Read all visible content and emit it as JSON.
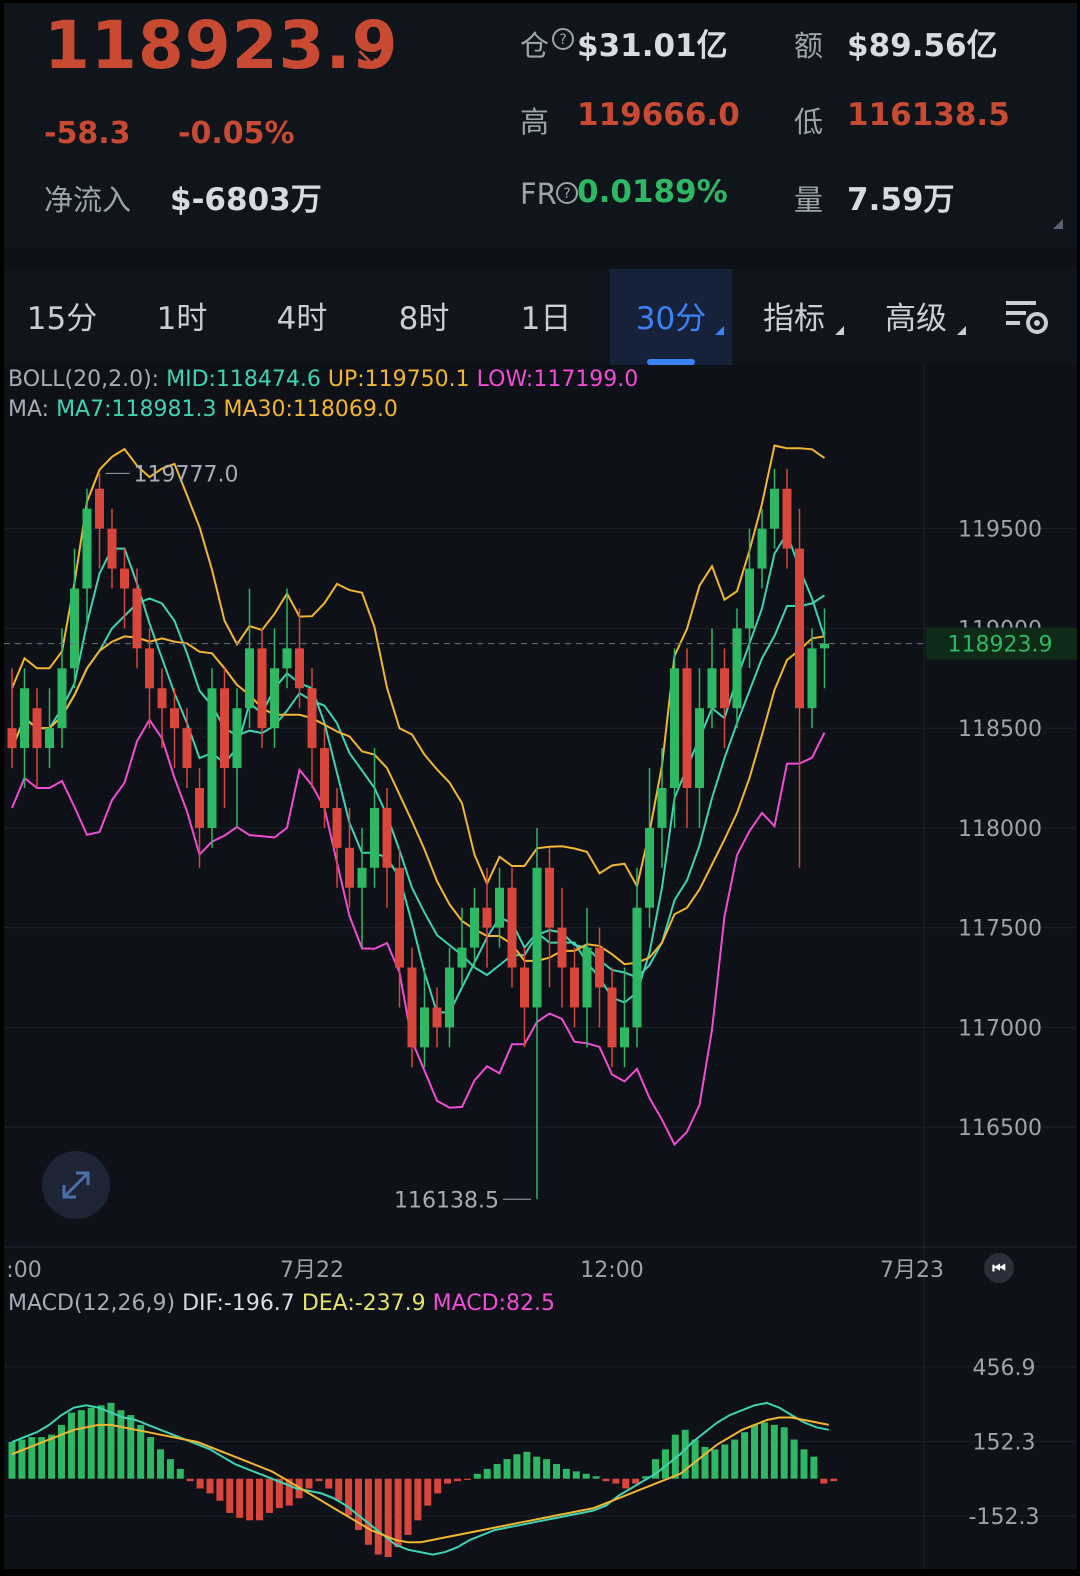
{
  "header": {
    "price": "118923.9",
    "change": "-58.3",
    "change_pct": "-0.05%",
    "net_inflow_label": "净流入",
    "net_inflow_value": "$-6803万",
    "oi_label": "仓",
    "oi_value": "$31.01亿",
    "turnover_label": "额",
    "turnover_value": "$89.56亿",
    "high_label": "高",
    "high_value": "119666.0",
    "low_label": "低",
    "low_value": "116138.5",
    "fr_label": "FR",
    "fr_value": "0.0189%",
    "volume_label": "量",
    "volume_value": "7.59万"
  },
  "tabs": [
    {
      "label": "15分"
    },
    {
      "label": "1时"
    },
    {
      "label": "4时"
    },
    {
      "label": "8时"
    },
    {
      "label": "1日"
    },
    {
      "label": "30分"
    },
    {
      "label": "指标"
    },
    {
      "label": "高级"
    }
  ],
  "active_tab": "30分",
  "icons": {
    "settings": "chart-settings-icon",
    "expand": "expand-icon",
    "rewind": "rewind-to-latest-icon",
    "help": "question-circle-icon"
  },
  "colors": {
    "up": "#2fb864",
    "down": "#d9463b",
    "mid": "#3fd3b4",
    "upper": "#f2b632",
    "lower": "#f04dd6",
    "dif": "#3fd3b4",
    "dea": "#f2b632"
  },
  "legends": {
    "boll_prefix": "BOLL(20,2.0):",
    "boll_mid": "MID:118474.6",
    "boll_up": "UP:119750.1",
    "boll_low": "LOW:117199.0",
    "ma_prefix": "MA:",
    "ma7": "MA7:118981.3",
    "ma30": "MA30:118069.0",
    "macd_prefix": "MACD(12,26,9)",
    "macd_dif": "DIF:-196.7",
    "macd_dea": "DEA:-237.9",
    "macd_val": "MACD:82.5"
  },
  "chart_data": {
    "type": "candlestick",
    "ylim": [
      116000,
      120200
    ],
    "y_ticks": [
      119500,
      119000,
      118500,
      118000,
      117500,
      117000,
      116500
    ],
    "y_tick_labels": [
      "119500",
      "119000",
      "118500",
      "118000",
      "117500",
      "117000",
      "116500"
    ],
    "x_labels": [
      {
        "text": ":00",
        "index": 0
      },
      {
        "text": "7月22",
        "index": 24
      },
      {
        "text": "12:00",
        "index": 48
      },
      {
        "text": "7月23",
        "index": 72
      }
    ],
    "last_price": 118923.9,
    "last_price_label": "118923.9",
    "max_marker": {
      "value": 119777.0,
      "label": "119777.0",
      "index": 7
    },
    "min_marker": {
      "value": 116138.5,
      "label": "116138.5",
      "index": 42
    },
    "candles": [
      [
        118500,
        118400,
        118800,
        118300
      ],
      [
        118400,
        118700,
        118800,
        118200
      ],
      [
        118600,
        118400,
        118700,
        118200
      ],
      [
        118400,
        118500,
        118700,
        118300
      ],
      [
        118500,
        118800,
        119000,
        118400
      ],
      [
        118800,
        119200,
        119400,
        118700
      ],
      [
        119200,
        119600,
        119700,
        119000
      ],
      [
        119700,
        119500,
        119777,
        119300
      ],
      [
        119500,
        119300,
        119600,
        119200
      ],
      [
        119300,
        119200,
        119400,
        119000
      ],
      [
        119200,
        118900,
        119300,
        118800
      ],
      [
        118900,
        118700,
        119000,
        118500
      ],
      [
        118700,
        118600,
        118800,
        118400
      ],
      [
        118600,
        118500,
        118700,
        118300
      ],
      [
        118500,
        118300,
        118600,
        118200
      ],
      [
        118200,
        118000,
        118300,
        117800
      ],
      [
        118000,
        118700,
        118800,
        117900
      ],
      [
        118700,
        118300,
        118800,
        118100
      ],
      [
        118300,
        118600,
        118700,
        118000
      ],
      [
        118600,
        118900,
        119200,
        118500
      ],
      [
        118900,
        118500,
        119000,
        118400
      ],
      [
        118500,
        118800,
        119000,
        118400
      ],
      [
        118800,
        118900,
        119200,
        118700
      ],
      [
        118900,
        118700,
        119100,
        118600
      ],
      [
        118700,
        118400,
        118800,
        118200
      ],
      [
        118400,
        118100,
        118500,
        118000
      ],
      [
        118100,
        117900,
        118200,
        117700
      ],
      [
        117900,
        117700,
        118100,
        117600
      ],
      [
        117700,
        117800,
        118000,
        117400
      ],
      [
        117800,
        118100,
        118400,
        117700
      ],
      [
        118100,
        117800,
        118200,
        117600
      ],
      [
        117800,
        117300,
        117900,
        117100
      ],
      [
        117300,
        116900,
        117400,
        116800
      ],
      [
        116900,
        117100,
        117300,
        116800
      ],
      [
        117100,
        117000,
        117200,
        116900
      ],
      [
        117000,
        117300,
        117400,
        116900
      ],
      [
        117300,
        117400,
        117600,
        117200
      ],
      [
        117400,
        117600,
        117700,
        117300
      ],
      [
        117600,
        117500,
        117800,
        117300
      ],
      [
        117500,
        117700,
        117800,
        117400
      ],
      [
        117700,
        117300,
        117800,
        117200
      ],
      [
        117300,
        117100,
        117400,
        116900
      ],
      [
        117100,
        117800,
        118000,
        116138.5
      ],
      [
        117800,
        117500,
        117900,
        117200
      ],
      [
        117500,
        117300,
        117700,
        117100
      ],
      [
        117300,
        117100,
        117400,
        117000
      ],
      [
        117100,
        117400,
        117600,
        116900
      ],
      [
        117400,
        117200,
        117500,
        117000
      ],
      [
        117200,
        116900,
        117300,
        116800
      ],
      [
        116900,
        117000,
        117300,
        116800
      ],
      [
        117000,
        117600,
        117800,
        116900
      ],
      [
        117600,
        118000,
        118300,
        117500
      ],
      [
        118000,
        118200,
        118400,
        117800
      ],
      [
        118200,
        118800,
        118900,
        118000
      ],
      [
        118800,
        118200,
        118900,
        118000
      ],
      [
        118200,
        118600,
        118800,
        118000
      ],
      [
        118600,
        118800,
        119000,
        118500
      ],
      [
        118800,
        118600,
        118900,
        118400
      ],
      [
        118600,
        119000,
        119100,
        118500
      ],
      [
        119000,
        119300,
        119500,
        118800
      ],
      [
        119300,
        119500,
        119600,
        119200
      ],
      [
        119500,
        119700,
        119800,
        119400
      ],
      [
        119700,
        119400,
        119800,
        119300
      ],
      [
        119400,
        118600,
        119600,
        117800
      ],
      [
        118600,
        118900,
        119000,
        118500
      ],
      [
        118900,
        118923.9,
        119100,
        118700
      ]
    ]
  },
  "macd_data": {
    "ylim": [
      -320,
      620
    ],
    "ticks": [
      456.9,
      152.3,
      -152.3
    ],
    "tick_labels": [
      "456.9",
      "152.3",
      "-152.3"
    ],
    "hist": [
      150,
      160,
      170,
      170,
      180,
      220,
      270,
      280,
      290,
      300,
      310,
      280,
      260,
      220,
      170,
      120,
      80,
      40,
      -10,
      -40,
      -60,
      -90,
      -140,
      -160,
      -170,
      -170,
      -140,
      -120,
      -110,
      -80,
      -40,
      -10,
      -40,
      -90,
      -150,
      -210,
      -270,
      -310,
      -320,
      -280,
      -230,
      -170,
      -110,
      -60,
      -20,
      -10,
      -5,
      20,
      40,
      60,
      80,
      100,
      110,
      90,
      80,
      60,
      40,
      30,
      20,
      10,
      -10,
      -20,
      -40,
      -20,
      10,
      80,
      120,
      180,
      200,
      160,
      130,
      120,
      140,
      160,
      190,
      220,
      230,
      220,
      210,
      160,
      120,
      90,
      -20,
      -10
    ],
    "dif": [
      150,
      170,
      190,
      220,
      260,
      290,
      300,
      290,
      270,
      250,
      240,
      220,
      200,
      180,
      160,
      140,
      120,
      90,
      60,
      40,
      20,
      0,
      -20,
      -40,
      -50,
      -60,
      -80,
      -110,
      -150,
      -190,
      -230,
      -270,
      -290,
      -300,
      -310,
      -300,
      -280,
      -250,
      -230,
      -210,
      -200,
      -190,
      -180,
      -170,
      -160,
      -150,
      -140,
      -130,
      -110,
      -70,
      -40,
      -10,
      20,
      60,
      100,
      150,
      190,
      230,
      260,
      280,
      300,
      310,
      290,
      260,
      230,
      210,
      200
    ],
    "dea": [
      100,
      120,
      140,
      160,
      180,
      200,
      210,
      220,
      220,
      210,
      200,
      190,
      180,
      170,
      160,
      150,
      130,
      110,
      90,
      70,
      50,
      30,
      0,
      -30,
      -60,
      -90,
      -120,
      -150,
      -180,
      -210,
      -230,
      -250,
      -260,
      -260,
      -250,
      -240,
      -230,
      -220,
      -210,
      -200,
      -190,
      -180,
      -170,
      -160,
      -150,
      -140,
      -130,
      -120,
      -100,
      -80,
      -60,
      -40,
      -20,
      0,
      20,
      60,
      100,
      140,
      170,
      200,
      220,
      240,
      250,
      250,
      240,
      230,
      220
    ]
  }
}
